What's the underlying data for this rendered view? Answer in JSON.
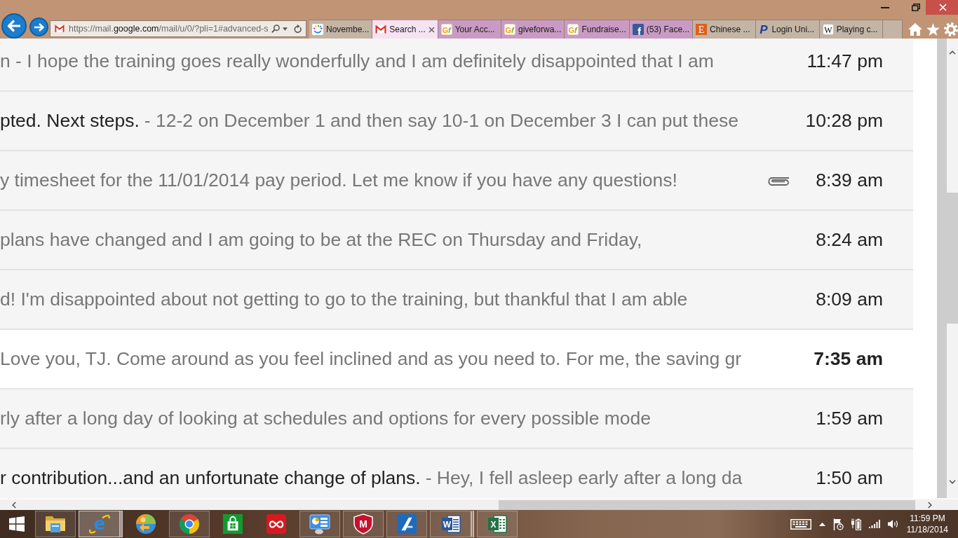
{
  "browser": {
    "address_bar": {
      "url_start": "https://mail.",
      "url_domain": "google.com",
      "url_end": "/mail/u/0/?pli=1#advanced-s"
    },
    "tabs": [
      {
        "label": "Novembe...",
        "selected": false,
        "color": "#c4b4a5"
      },
      {
        "label": "Search ...",
        "selected": true,
        "color": "#f5e3f2"
      },
      {
        "label": "Your Acc...",
        "selected": false,
        "color": "#c99bc4",
        "icon_text": "Gf"
      },
      {
        "label": "giveforwa...",
        "selected": false,
        "color": "#c99bc4",
        "icon_text": "Gf"
      },
      {
        "label": "Fundraise...",
        "selected": false,
        "color": "#c99bc4",
        "icon_text": "Gf"
      },
      {
        "label": "(53) Face...",
        "selected": false,
        "color": "#c99bc4",
        "icon_text": "f"
      },
      {
        "label": "Chinese ...",
        "selected": false,
        "color": "#c4b4a5",
        "icon_text": "E"
      },
      {
        "label": "Login Uni...",
        "selected": false,
        "color": "#c4b4a5",
        "icon_text": "P"
      },
      {
        "label": "Playing c...",
        "selected": false,
        "color": "#c4b4a5",
        "icon_text": "W"
      }
    ]
  },
  "messages": [
    {
      "snippet": "n - I hope the training goes really wonderfully and I am definitely disappointed that I am",
      "time": "11:47 pm",
      "unread": false,
      "attachment": false
    },
    {
      "subject": "pted. Next steps.",
      "snippet": "- 12-2 on December 1 and then say 10-1 on December 3 I can put these",
      "time": "10:28 pm",
      "unread": false,
      "attachment": false
    },
    {
      "snippet": "y timesheet for the 11/01/2014 pay period. Let me know if you have any questions!",
      "time": "8:39 am",
      "unread": false,
      "attachment": true
    },
    {
      "snippet": "plans have changed and I am going to be at the REC on Thursday and Friday,",
      "time": "8:24 am",
      "unread": false,
      "attachment": false
    },
    {
      "snippet": "d! I'm disappointed about not getting to go to the training, but thankful that I am able",
      "time": "8:09 am",
      "unread": false,
      "attachment": false
    },
    {
      "snippet": "Love you, TJ. Come around as you feel inclined and as you need to. For me, the saving gr",
      "time": "7:35 am",
      "unread": true,
      "attachment": false
    },
    {
      "snippet": "rly after a long day of looking at schedules and options for every possible mode",
      "time": "1:59 am",
      "unread": false,
      "attachment": false
    },
    {
      "subject": "r contribution...and an unfortunate change of plans.",
      "snippet": "- Hey, I fell asleep early after a long da",
      "time": "1:50 am",
      "unread": false,
      "attachment": false
    }
  ],
  "taskbar": {
    "apps": [
      {
        "running": true,
        "selected": false,
        "stacked": false
      },
      {
        "running": true,
        "selected": true,
        "stacked": true,
        "icon_text": "e"
      },
      {
        "running": false,
        "selected": false,
        "stacked": false
      },
      {
        "running": true,
        "selected": false,
        "stacked": false
      },
      {
        "running": false,
        "selected": false,
        "stacked": false
      },
      {
        "running": false,
        "selected": false,
        "stacked": false
      },
      {
        "running": true,
        "selected": false,
        "stacked": false
      },
      {
        "running": true,
        "selected": false,
        "stacked": false,
        "icon_text": "M"
      },
      {
        "running": true,
        "selected": false,
        "stacked": false
      },
      {
        "running": true,
        "selected": false,
        "stacked": true,
        "icon_text": "W"
      },
      {
        "running": true,
        "selected": false,
        "stacked": false,
        "icon_text": "X"
      }
    ],
    "clock": {
      "time": "11:59 PM",
      "date": "11/18/2014"
    }
  }
}
